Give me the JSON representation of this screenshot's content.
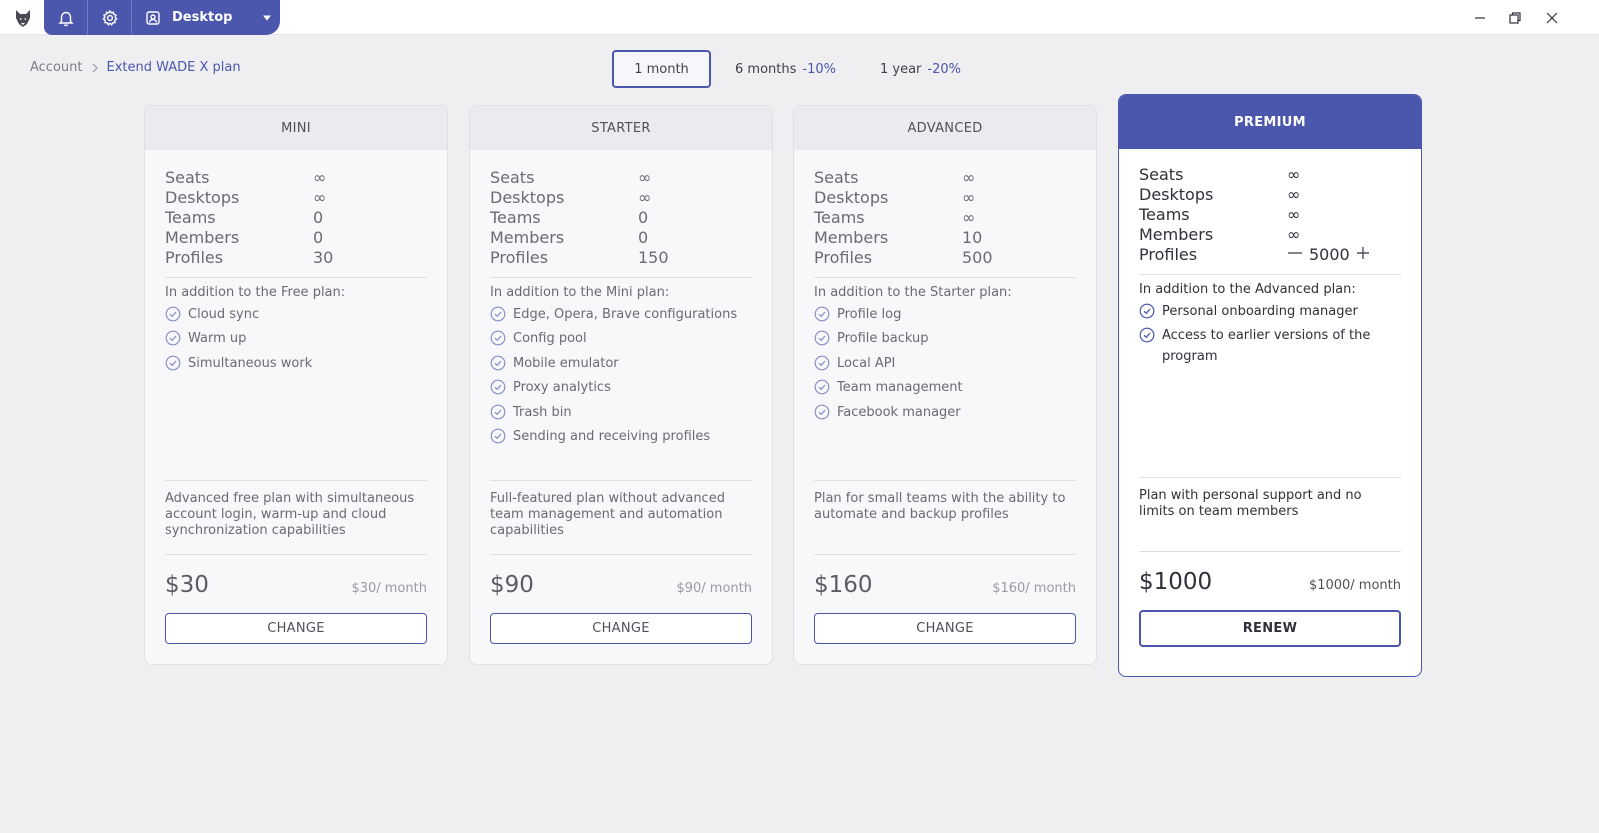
{
  "titlebar": {
    "tab_label": "Desktop",
    "icons": [
      "wolf-logo-icon",
      "bell-icon",
      "gear-icon",
      "desktop-profile-icon",
      "caret-down-icon"
    ]
  },
  "window_controls": [
    "minimize-icon",
    "restore-icon",
    "close-icon"
  ],
  "breadcrumb": {
    "parent": "Account",
    "current": "Extend WADE X plan"
  },
  "period": {
    "options": [
      {
        "label": "1 month",
        "discount": "",
        "selected": true
      },
      {
        "label": "6 months",
        "discount": "-10%",
        "selected": false
      },
      {
        "label": "1 year",
        "discount": "-20%",
        "selected": false
      }
    ]
  },
  "colors": {
    "accent": "#4b56ad",
    "background": "#efeff2",
    "card": "#f8f8fa"
  },
  "plans": [
    {
      "name": "MINI",
      "specs": [
        {
          "label": "Seats",
          "value": "∞"
        },
        {
          "label": "Desktops",
          "value": "∞"
        },
        {
          "label": "Teams",
          "value": "0"
        },
        {
          "label": "Members",
          "value": "0"
        },
        {
          "label": "Profiles",
          "value": "30"
        }
      ],
      "intro": "In addition to the Free plan:",
      "features": [
        "Cloud sync",
        "Warm up",
        "Simultaneous work"
      ],
      "description": "Advanced free plan with simultaneous account login, warm-up and cloud synchronization capabilities",
      "price": "$30",
      "per_month": "$30/ month",
      "button": "CHANGE"
    },
    {
      "name": "STARTER",
      "specs": [
        {
          "label": "Seats",
          "value": "∞"
        },
        {
          "label": "Desktops",
          "value": "∞"
        },
        {
          "label": "Teams",
          "value": "0"
        },
        {
          "label": "Members",
          "value": "0"
        },
        {
          "label": "Profiles",
          "value": "150"
        }
      ],
      "intro": "In addition to the Mini plan:",
      "features": [
        "Edge, Opera, Brave configurations",
        "Config pool",
        "Mobile emulator",
        "Proxy analytics",
        "Trash bin",
        "Sending and receiving profiles"
      ],
      "description": "Full-featured plan without advanced team management and automation capabilities",
      "price": "$90",
      "per_month": "$90/ month",
      "button": "CHANGE"
    },
    {
      "name": "ADVANCED",
      "specs": [
        {
          "label": "Seats",
          "value": "∞"
        },
        {
          "label": "Desktops",
          "value": "∞"
        },
        {
          "label": "Teams",
          "value": "∞"
        },
        {
          "label": "Members",
          "value": "10"
        },
        {
          "label": "Profiles",
          "value": "500"
        }
      ],
      "intro": "In addition to the Starter plan:",
      "features": [
        "Profile log",
        "Profile backup",
        "Local API",
        "Team management",
        "Facebook manager"
      ],
      "description": "Plan for small teams with the ability to automate and backup profiles",
      "price": "$160",
      "per_month": "$160/ month",
      "button": "CHANGE"
    },
    {
      "name": "PREMIUM",
      "specs": [
        {
          "label": "Seats",
          "value": "∞"
        },
        {
          "label": "Desktops",
          "value": "∞"
        },
        {
          "label": "Teams",
          "value": "∞"
        },
        {
          "label": "Members",
          "value": "∞"
        },
        {
          "label": "Profiles",
          "value": "5000"
        }
      ],
      "intro": "In addition to the Advanced plan:",
      "features": [
        "Personal onboarding manager",
        "Access to earlier versions of the program"
      ],
      "description": "Plan with personal support and no limits on team members",
      "price": "$1000",
      "per_month": "$1000/ month",
      "button": "RENEW"
    }
  ]
}
